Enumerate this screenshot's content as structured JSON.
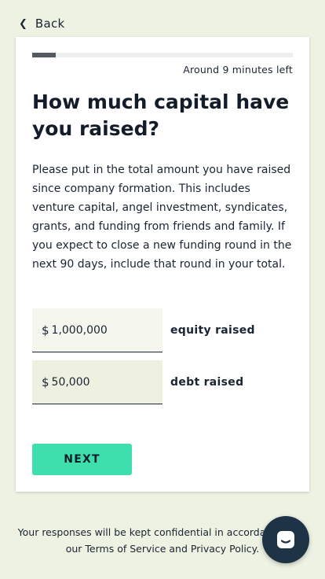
{
  "nav": {
    "back_label": "Back"
  },
  "progress": {
    "fraction": 0.09,
    "time_left": "Around 9 minutes left"
  },
  "question": {
    "title": "How much capital have you raised?",
    "description": "Please put in the total amount you have raised since company formation. This includes venture capital, angel investment, syndicates, grants, and funding from friends and family. If you expect to close a new funding round in the next 90 days, include that round in your total."
  },
  "fields": {
    "equity": {
      "currency": "$",
      "value": "1,000,000",
      "label": "equity raised"
    },
    "debt": {
      "currency": "$",
      "value": "50,000",
      "label": "debt raised"
    }
  },
  "actions": {
    "next_label": "NEXT"
  },
  "footer": {
    "line1": "Your responses will be kept confidential in accordance with",
    "line2": "our Terms of Service and Privacy Policy."
  },
  "colors": {
    "background": "#eef2e3",
    "accent": "#3ddfac",
    "chat": "#1f3347",
    "text": "#1a2433"
  },
  "icons": {
    "back": "chevron-left-icon",
    "chat": "chat-bubble-icon"
  }
}
